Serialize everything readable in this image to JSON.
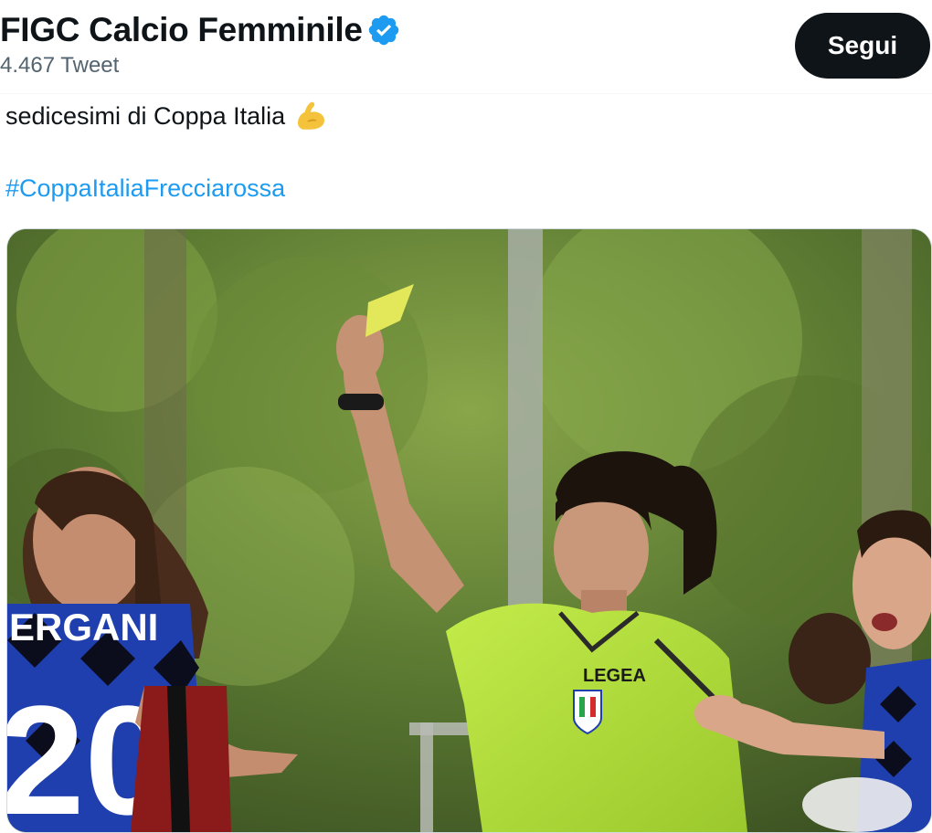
{
  "profile": {
    "name": "FIGC Calcio Femminile",
    "tweet_count": "4.467 Tweet",
    "verified_icon": "verified-badge-icon"
  },
  "follow_button": {
    "label": "Segui"
  },
  "tweet": {
    "text": "sedicesimi di Coppa Italia",
    "emoji": "flexed-biceps-icon",
    "hashtag": "#CoppaItaliaFrecciarossa"
  },
  "photo": {
    "jersey_text": "ERGANI",
    "jersey_number": "20",
    "kit_brand": "LEGEA"
  },
  "colors": {
    "accent": "#1d9bf0",
    "button_bg": "#0f1419",
    "muted": "#536471",
    "referee_kit": "#b6e23a",
    "yellow_card": "#e3e85a",
    "inter_blue": "#1f3fae"
  }
}
